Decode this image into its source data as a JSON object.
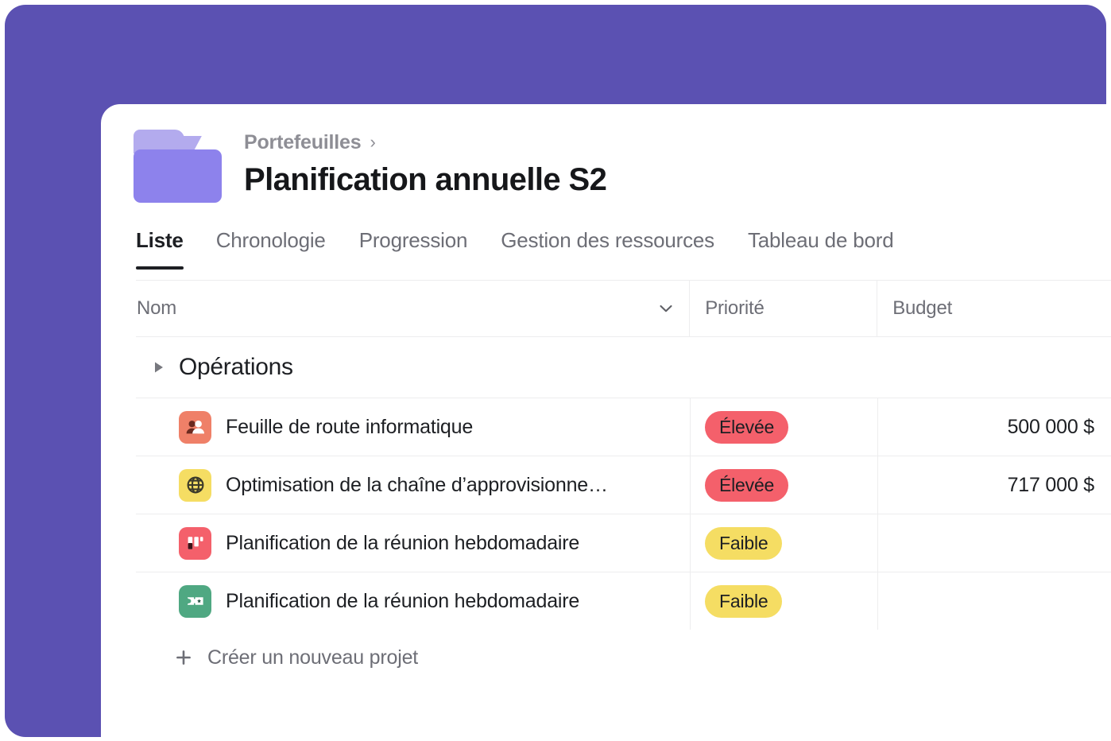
{
  "theme": {
    "backdrop_purple": "#5b51b2",
    "card_white": "#ffffff",
    "text_primary": "#1d1f23",
    "text_muted": "#6d6e76",
    "divider": "#ededee",
    "folder_body": "#8d82ec",
    "folder_tab": "#b3abee",
    "badge_high_bg": "#f4606b",
    "badge_low_bg": "#f5dd63"
  },
  "header": {
    "folder_icon": "folder-icon",
    "breadcrumb": {
      "parent": "Portefeuilles",
      "separator": "›"
    },
    "title": "Planification annuelle S2"
  },
  "tabs": [
    {
      "label": "Liste",
      "active": true
    },
    {
      "label": "Chronologie",
      "active": false
    },
    {
      "label": "Progression",
      "active": false
    },
    {
      "label": "Gestion des ressources",
      "active": false
    },
    {
      "label": "Tableau de bord",
      "active": false
    }
  ],
  "table": {
    "columns": [
      {
        "key": "name",
        "label": "Nom",
        "has_sort_caret": true
      },
      {
        "key": "priority",
        "label": "Priorité",
        "has_sort_caret": false
      },
      {
        "key": "budget",
        "label": "Budget",
        "has_sort_caret": false
      }
    ],
    "groups": [
      {
        "label": "Opérations",
        "collapsed": false,
        "caret_icon": "triangle-right-icon",
        "rows": [
          {
            "icon": "users-icon",
            "icon_bg": "#ef8068",
            "name": "Feuille de route informatique",
            "priority": "Élevée",
            "priority_level": "high",
            "budget": "500 000 $"
          },
          {
            "icon": "globe-icon",
            "icon_bg": "#f5dd63",
            "name": "Optimisation de la chaîne d’approvisionne…",
            "priority": "Élevée",
            "priority_level": "high",
            "budget": ""
          },
          {
            "icon": "board-icon",
            "icon_bg": "#f4606b",
            "name": "Planification de la réunion hebdomadaire",
            "priority": "Faible",
            "priority_level": "low",
            "budget": ""
          },
          {
            "icon": "ticket-icon",
            "icon_bg": "#4fa882",
            "name": "Planification de la réunion hebdomadaire",
            "priority": "Faible",
            "priority_level": "low",
            "budget": ""
          }
        ]
      }
    ],
    "row_budgets_override": [
      "500 000 $",
      "717 000 $",
      "",
      ""
    ],
    "add_row": {
      "icon": "plus-icon",
      "label": "Créer un nouveau projet"
    }
  }
}
